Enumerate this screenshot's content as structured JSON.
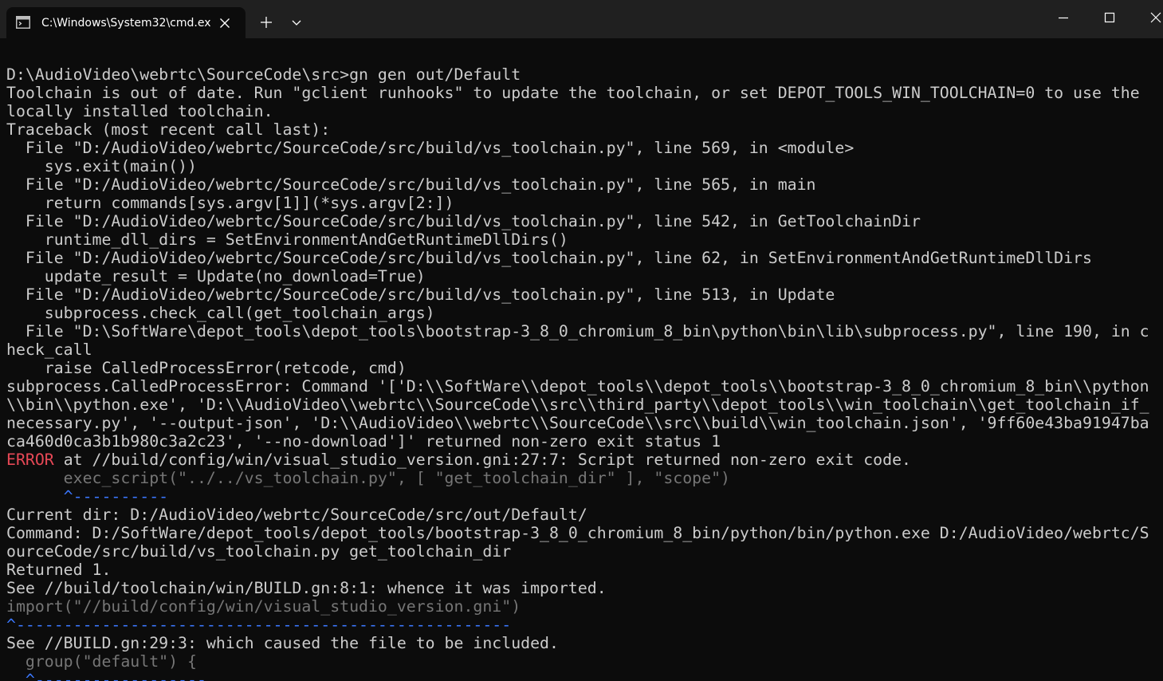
{
  "window": {
    "tab_title": "C:\\Windows\\System32\\cmd.ex",
    "icons": {
      "tab": "terminal-icon",
      "tab_close": "close-icon",
      "new_tab": "plus-icon",
      "dropdown": "chevron-down-icon",
      "minimize": "minimize-icon",
      "maximize": "maximize-icon",
      "close": "close-icon"
    }
  },
  "colors": {
    "background": "#0c0c0c",
    "titlebar": "#202020",
    "text": "#cccccc",
    "error": "#e74856",
    "dim": "#767676",
    "caret": "#3b78ff"
  },
  "console": {
    "lines": [
      {
        "segments": [
          {
            "text": "D:\\AudioVideo\\webrtc\\SourceCode\\src>gn gen out/Default",
            "style": "n"
          }
        ]
      },
      {
        "segments": [
          {
            "text": "Toolchain is out of date. Run \"gclient runhooks\" to update the toolchain, or set DEPOT_TOOLS_WIN_TOOLCHAIN=0 to use the",
            "style": "n"
          }
        ]
      },
      {
        "segments": [
          {
            "text": "locally installed toolchain.",
            "style": "n"
          }
        ]
      },
      {
        "segments": [
          {
            "text": "Traceback (most recent call last):",
            "style": "n"
          }
        ]
      },
      {
        "segments": [
          {
            "text": "  File \"D:/AudioVideo/webrtc/SourceCode/src/build/vs_toolchain.py\", line 569, in <module>",
            "style": "n"
          }
        ]
      },
      {
        "segments": [
          {
            "text": "    sys.exit(main())",
            "style": "n"
          }
        ]
      },
      {
        "segments": [
          {
            "text": "  File \"D:/AudioVideo/webrtc/SourceCode/src/build/vs_toolchain.py\", line 565, in main",
            "style": "n"
          }
        ]
      },
      {
        "segments": [
          {
            "text": "    return commands[sys.argv[1]](*sys.argv[2:])",
            "style": "n"
          }
        ]
      },
      {
        "segments": [
          {
            "text": "  File \"D:/AudioVideo/webrtc/SourceCode/src/build/vs_toolchain.py\", line 542, in GetToolchainDir",
            "style": "n"
          }
        ]
      },
      {
        "segments": [
          {
            "text": "    runtime_dll_dirs = SetEnvironmentAndGetRuntimeDllDirs()",
            "style": "n"
          }
        ]
      },
      {
        "segments": [
          {
            "text": "  File \"D:/AudioVideo/webrtc/SourceCode/src/build/vs_toolchain.py\", line 62, in SetEnvironmentAndGetRuntimeDllDirs",
            "style": "n"
          }
        ]
      },
      {
        "segments": [
          {
            "text": "    update_result = Update(no_download=True)",
            "style": "n"
          }
        ]
      },
      {
        "segments": [
          {
            "text": "  File \"D:/AudioVideo/webrtc/SourceCode/src/build/vs_toolchain.py\", line 513, in Update",
            "style": "n"
          }
        ]
      },
      {
        "segments": [
          {
            "text": "    subprocess.check_call(get_toolchain_args)",
            "style": "n"
          }
        ]
      },
      {
        "segments": [
          {
            "text": "  File \"D:\\SoftWare\\depot_tools\\depot_tools\\bootstrap-3_8_0_chromium_8_bin\\python\\bin\\lib\\subprocess.py\", line 190, in c",
            "style": "n"
          }
        ]
      },
      {
        "segments": [
          {
            "text": "heck_call",
            "style": "n"
          }
        ]
      },
      {
        "segments": [
          {
            "text": "    raise CalledProcessError(retcode, cmd)",
            "style": "n"
          }
        ]
      },
      {
        "segments": [
          {
            "text": "subprocess.CalledProcessError: Command '['D:\\\\SoftWare\\\\depot_tools\\\\depot_tools\\\\bootstrap-3_8_0_chromium_8_bin\\\\python",
            "style": "n"
          }
        ]
      },
      {
        "segments": [
          {
            "text": "\\\\bin\\\\python.exe', 'D:\\\\AudioVideo\\\\webrtc\\\\SourceCode\\\\src\\\\third_party\\\\depot_tools\\\\win_toolchain\\\\get_toolchain_if_",
            "style": "n"
          }
        ]
      },
      {
        "segments": [
          {
            "text": "necessary.py', '--output-json', 'D:\\\\AudioVideo\\\\webrtc\\\\SourceCode\\\\src\\\\build\\\\win_toolchain.json', '9ff60e43ba91947ba",
            "style": "n"
          }
        ]
      },
      {
        "segments": [
          {
            "text": "ca460d0ca3b1b980c3a2c23', '--no-download']' returned non-zero exit status 1",
            "style": "n"
          }
        ]
      },
      {
        "segments": [
          {
            "text": "ERROR",
            "style": "e"
          },
          {
            "text": " at //build/config/win/visual_studio_version.gni:27:7: Script returned non-zero exit code.",
            "style": "n"
          }
        ]
      },
      {
        "segments": [
          {
            "text": "      exec_script(\"../../vs_toolchain.py\", [ \"get_toolchain_dir\" ], \"scope\")",
            "style": "d"
          }
        ]
      },
      {
        "segments": [
          {
            "text": "      ^----------",
            "style": "b"
          }
        ]
      },
      {
        "segments": [
          {
            "text": "Current dir: D:/AudioVideo/webrtc/SourceCode/src/out/Default/",
            "style": "n"
          }
        ]
      },
      {
        "segments": [
          {
            "text": "Command: D:/SoftWare/depot_tools/depot_tools/bootstrap-3_8_0_chromium_8_bin/python/bin/python.exe D:/AudioVideo/webrtc/S",
            "style": "n"
          }
        ]
      },
      {
        "segments": [
          {
            "text": "ourceCode/src/build/vs_toolchain.py get_toolchain_dir",
            "style": "n"
          }
        ]
      },
      {
        "segments": [
          {
            "text": "Returned 1.",
            "style": "n"
          }
        ]
      },
      {
        "segments": [
          {
            "text": "See //build/toolchain/win/BUILD.gn:8:1: whence it was imported.",
            "style": "n"
          }
        ]
      },
      {
        "segments": [
          {
            "text": "import(\"//build/config/win/visual_studio_version.gni\")",
            "style": "d"
          }
        ]
      },
      {
        "segments": [
          {
            "text": "^----------------------------------------------------",
            "style": "b"
          }
        ]
      },
      {
        "segments": [
          {
            "text": "See //BUILD.gn:29:3: which caused the file to be included.",
            "style": "n"
          }
        ]
      },
      {
        "segments": [
          {
            "text": "  group(\"default\") {",
            "style": "d"
          }
        ]
      },
      {
        "segments": [
          {
            "text": "  ^------------------",
            "style": "b"
          }
        ]
      }
    ]
  }
}
